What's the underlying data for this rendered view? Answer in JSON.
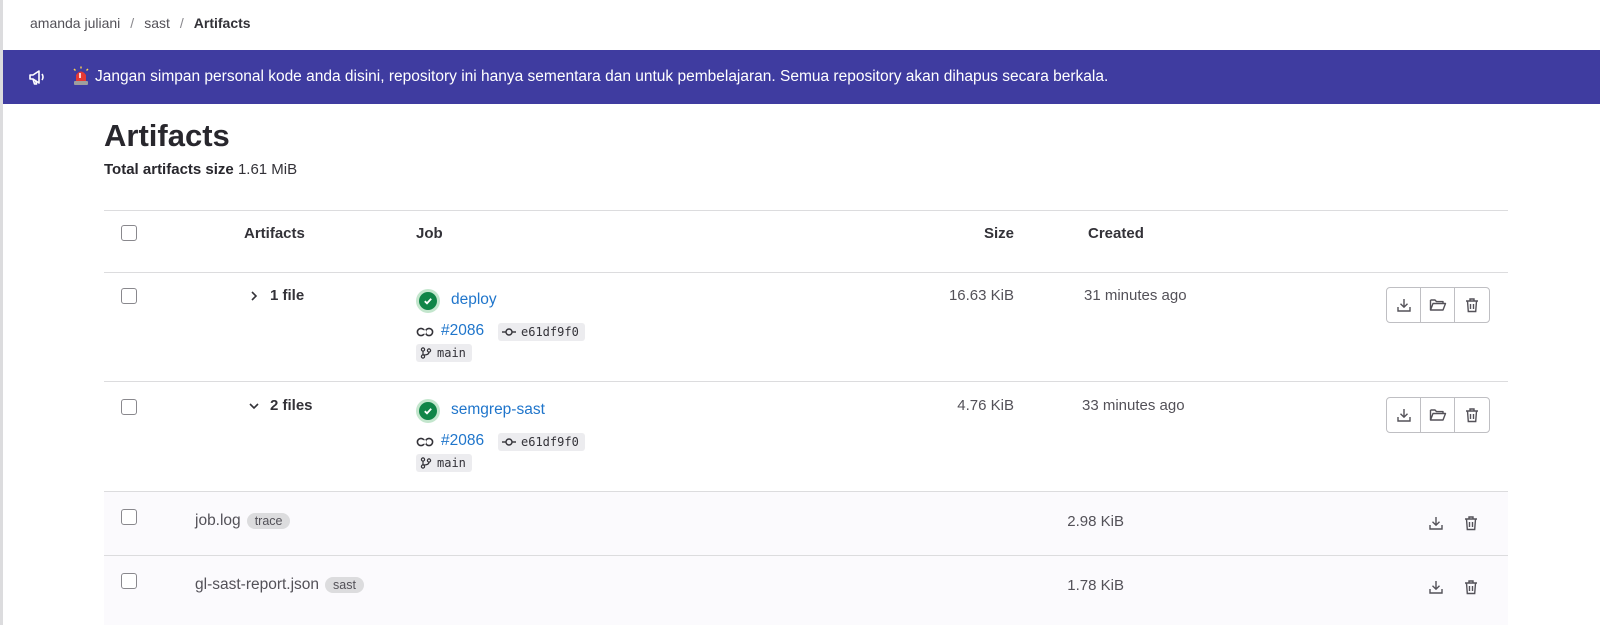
{
  "breadcrumb": {
    "items": [
      "amanda juliani",
      "sast"
    ],
    "current": "Artifacts"
  },
  "banner": {
    "icon": "megaphone-icon",
    "message": "Jangan simpan personal kode anda disini, repository ini hanya sementara dan untuk pembelajaran. Semua repository akan dihapus secara berkala.",
    "background": "#3f3ca0"
  },
  "page": {
    "title": "Artifacts",
    "total_label": "Total artifacts size",
    "total_value": "1.61 MiB"
  },
  "table": {
    "headers": {
      "artifacts": "Artifacts",
      "job": "Job",
      "size": "Size",
      "created": "Created"
    },
    "rows": [
      {
        "files_label": "1 file",
        "expanded": false,
        "job": "deploy",
        "status": "passed",
        "pipeline": "#2086",
        "commit": "e61df9f0",
        "branch": "main",
        "size": "16.63 KiB",
        "created": "31 minutes ago"
      },
      {
        "files_label": "2 files",
        "expanded": true,
        "job": "semgrep-sast",
        "status": "passed",
        "pipeline": "#2086",
        "commit": "e61df9f0",
        "branch": "main",
        "size": "4.76 KiB",
        "created": "33 minutes ago"
      }
    ],
    "files": [
      {
        "name": "job.log",
        "badge": "trace",
        "size": "2.98 KiB"
      },
      {
        "name": "gl-sast-report.json",
        "badge": "sast",
        "size": "1.78 KiB"
      }
    ]
  },
  "colors": {
    "link": "#1f75cb",
    "success": "#108548"
  }
}
